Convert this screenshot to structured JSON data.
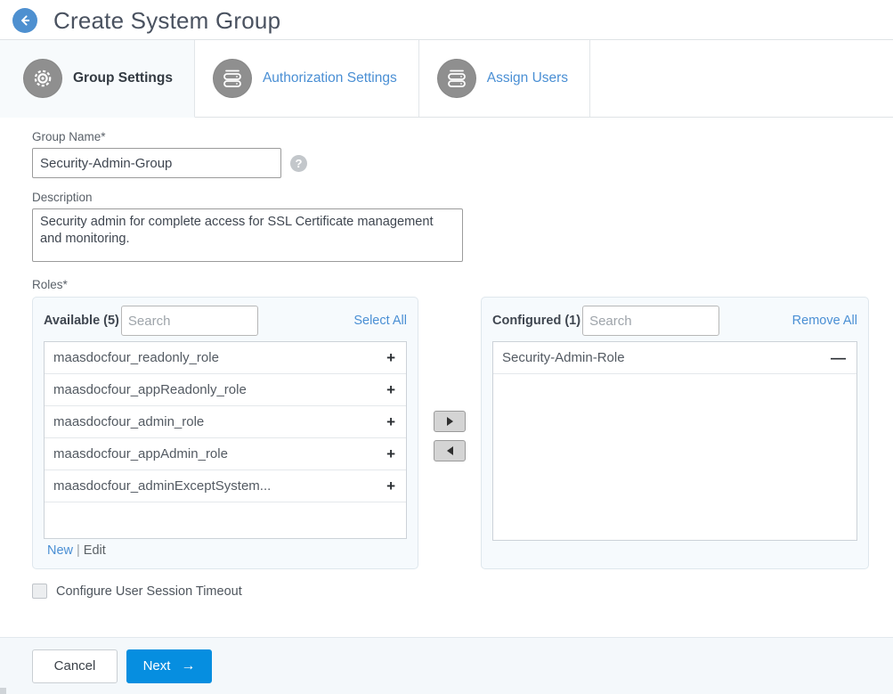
{
  "header": {
    "back_icon": "arrow-left-circle-icon",
    "title": "Create System Group"
  },
  "tabs": [
    {
      "label": "Group Settings",
      "icon": "gear-icon",
      "active": true
    },
    {
      "label": "Authorization Settings",
      "icon": "server-stack-icon",
      "active": false
    },
    {
      "label": "Assign Users",
      "icon": "server-stack-icon",
      "active": false
    }
  ],
  "form": {
    "group_name": {
      "label": "Group Name*",
      "value": "Security-Admin-Group",
      "help_icon": "question-mark-icon"
    },
    "description": {
      "label": "Description",
      "value": "Security admin for complete access for SSL Certificate management and monitoring."
    },
    "roles": {
      "label": "Roles*",
      "available": {
        "title": "Available (5)",
        "search_placeholder": "Search",
        "search_value": "",
        "action_label": "Select All",
        "items": [
          {
            "name": "maasdocfour_readonly_role",
            "op": "+"
          },
          {
            "name": "maasdocfour_appReadonly_role",
            "op": "+"
          },
          {
            "name": "maasdocfour_admin_role",
            "op": "+"
          },
          {
            "name": "maasdocfour_appAdmin_role",
            "op": "+"
          },
          {
            "name": "maasdocfour_adminExceptSystem...",
            "op": "+"
          }
        ],
        "footer": {
          "new_label": "New",
          "separator": "|",
          "edit_label": "Edit"
        }
      },
      "movers": [
        {
          "icon": "triangle-right-icon",
          "name": "move-right-button"
        },
        {
          "icon": "triangle-left-icon",
          "name": "move-left-button"
        }
      ],
      "configured": {
        "title": "Configured (1)",
        "search_placeholder": "Search",
        "search_value": "",
        "action_label": "Remove All",
        "items": [
          {
            "name": "Security-Admin-Role",
            "op": "—"
          }
        ]
      }
    },
    "session_timeout": {
      "label": "Configure User Session Timeout",
      "checked": false
    }
  },
  "footer": {
    "cancel_label": "Cancel",
    "next_label": "Next",
    "next_arrow": "→"
  },
  "colors": {
    "accent_blue": "#068ee0",
    "link_blue": "#4a8fd4",
    "back_circle": "#4e90d0",
    "icon_gray": "#8f8f8f",
    "panel_bg": "#f6fafd",
    "footer_bg": "#f4f8fb"
  }
}
